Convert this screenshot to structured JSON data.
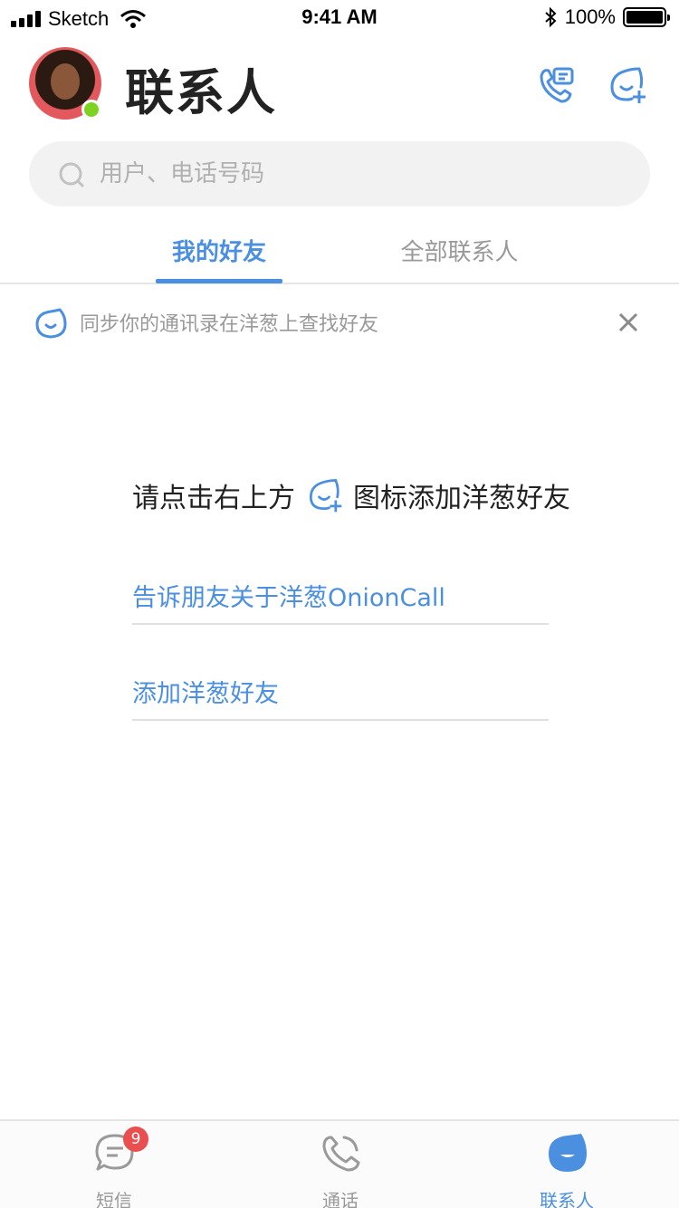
{
  "status_bar": {
    "carrier": "Sketch",
    "time": "9:41 AM",
    "battery_percent": "100%",
    "battery_level": 1.0
  },
  "header": {
    "title": "联系人",
    "online": true,
    "icons": {
      "call": "phone-message-icon",
      "add": "add-friend-icon"
    }
  },
  "search": {
    "placeholder": "用户、电话号码",
    "value": ""
  },
  "tabs": [
    {
      "label": "我的好友",
      "active": true
    },
    {
      "label": "全部联系人",
      "active": false
    }
  ],
  "sync_banner": {
    "text": "同步你的通讯录在洋葱上查找好友"
  },
  "empty_state": {
    "hint_before": "请点击右上方",
    "hint_after": "图标添加洋葱好友",
    "link_tell": "告诉朋友关于洋葱OnionCall",
    "link_add": "添加洋葱好友"
  },
  "tab_bar": {
    "items": [
      {
        "label": "短信",
        "icon": "message-icon",
        "badge": "9",
        "active": false
      },
      {
        "label": "通话",
        "icon": "phone-icon",
        "active": false
      },
      {
        "label": "联系人",
        "icon": "onion-contact-icon",
        "active": true
      }
    ]
  },
  "colors": {
    "accent": "#4a8fe0",
    "online": "#7ed321",
    "badge": "#e94f4f"
  }
}
